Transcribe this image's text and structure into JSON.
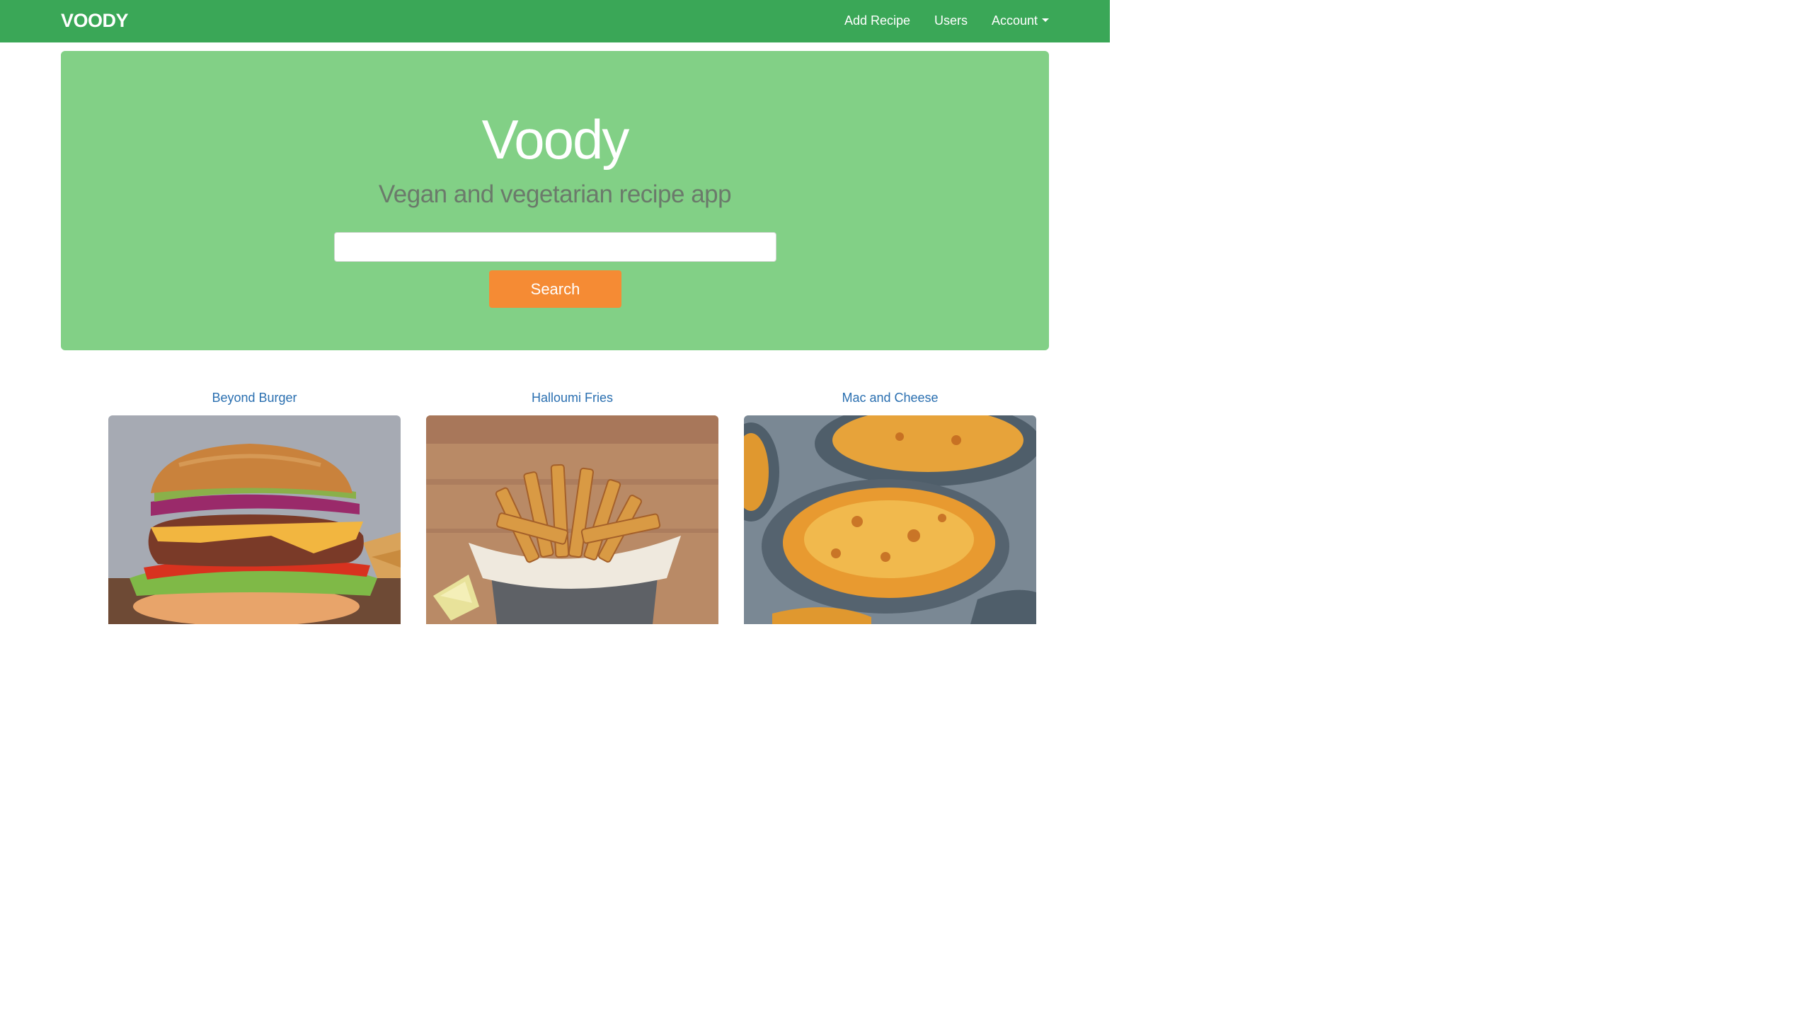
{
  "navbar": {
    "brand": "VOODY",
    "links": [
      {
        "label": "Add Recipe"
      },
      {
        "label": "Users"
      },
      {
        "label": "Account"
      }
    ],
    "background": "#3aa757"
  },
  "hero": {
    "title": "Voody",
    "subtitle": "Vegan and vegetarian recipe app",
    "search": {
      "value": "",
      "placeholder": ""
    },
    "search_button": "Search",
    "background": "#82d086",
    "button_color": "#f58b34"
  },
  "recipes": [
    {
      "title": "Beyond Burger",
      "image": "burger-photo"
    },
    {
      "title": "Halloumi Fries",
      "image": "halloumi-fries-photo"
    },
    {
      "title": "Mac and Cheese",
      "image": "mac-and-cheese-photo"
    }
  ],
  "link_color": "#2a6fb0"
}
